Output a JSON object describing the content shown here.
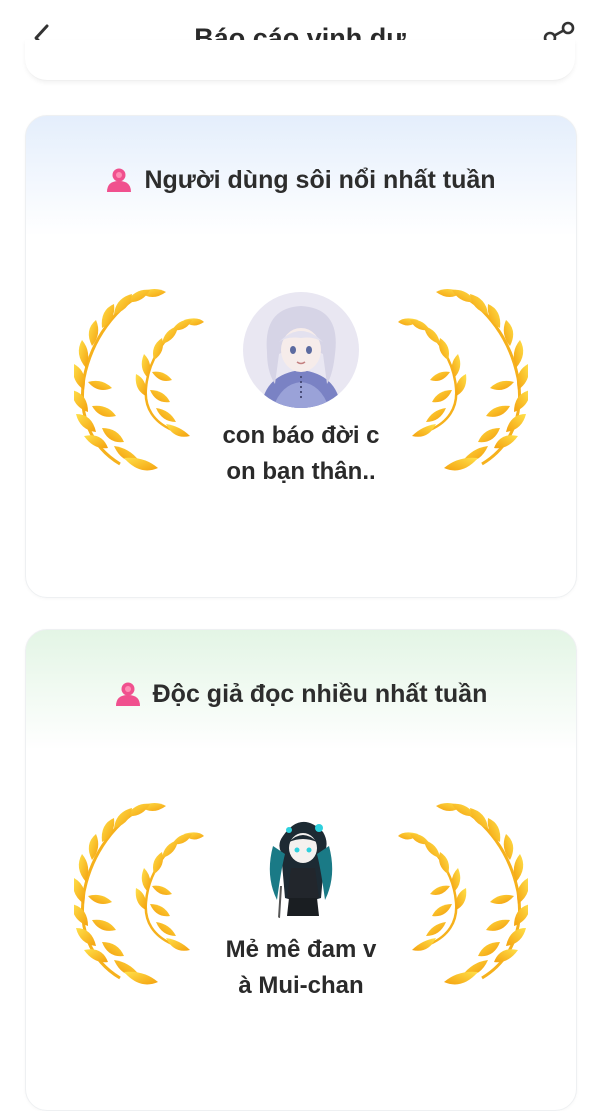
{
  "header": {
    "title": "Báo cáo vinh dự",
    "back_icon": "chevron-left-icon",
    "share_icon": "share-icon"
  },
  "cards": [
    {
      "title": "Người dùng sôi nổi nhất tuần",
      "icon": "user-icon",
      "user": {
        "name_line1": "con báo đời c",
        "name_line2": "on bạn thân.."
      }
    },
    {
      "title": "Độc giả đọc nhiều nhất tuần",
      "icon": "user-icon",
      "user": {
        "name_line1": "Mẻ mê đam v",
        "name_line2": "à Mui-chan"
      }
    }
  ],
  "colors": {
    "laurel_light": "#ffd23a",
    "laurel_dark": "#f5a00c",
    "user_icon": "#f0508e",
    "card1_top": "#e4eefc",
    "card2_top": "#e3f5e5"
  }
}
